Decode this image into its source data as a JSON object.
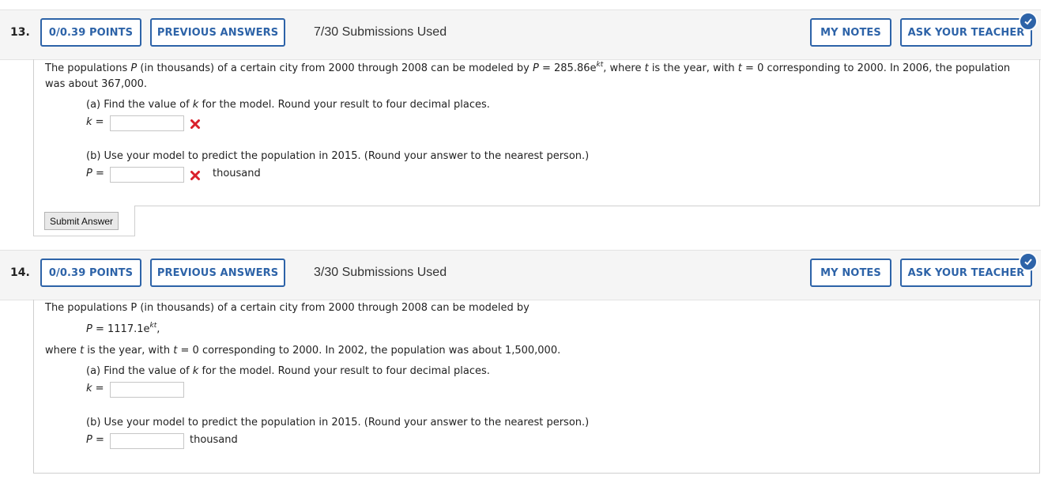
{
  "questions": [
    {
      "number": "13.",
      "points_label": "0/0.39 POINTS",
      "previous_answers_label": "PREVIOUS ANSWERS",
      "submissions": "7/30 Submissions Used",
      "my_notes_label": "MY NOTES",
      "ask_teacher_label": "ASK YOUR TEACHER",
      "intro_pre": "The populations ",
      "var_p": "P",
      "intro_mid": " (in thousands) of a certain city from 2000 through 2008 can be modeled by ",
      "model_eq": " = 285.86e",
      "model_exp": "kt",
      "intro_post": ", where ",
      "var_t": "t",
      "intro_post2": " is the year, with ",
      "intro_post3": " = 0 corresponding to 2000. In 2006, the population was about 367,000.",
      "part_a": "(a) Find the value of ",
      "part_a_var": "k",
      "part_a_post": " for the model. Round your result to four decimal places.",
      "k_label": " =",
      "k_value": "",
      "part_b": "(b) Use your model to predict the population in 2015. (Round your answer to the nearest person.)",
      "p_label": " =",
      "p_value": "",
      "unit": "thousand",
      "submit_label": "Submit Answer",
      "status_color": "#d9202b"
    },
    {
      "number": "14.",
      "points_label": "0/0.39 POINTS",
      "previous_answers_label": "PREVIOUS ANSWERS",
      "submissions": "3/30 Submissions Used",
      "my_notes_label": "MY NOTES",
      "ask_teacher_label": "ASK YOUR TEACHER",
      "intro": "The populations P (in thousands) of a certain city from 2000 through 2008 can be modeled by",
      "model_eq": " = 1117.1e",
      "model_exp": "kt",
      "model_tail": ",",
      "where_text": " is the year, with ",
      "where_text2": " = 0 corresponding to 2000. In 2002, the population was about 1,500,000.",
      "part_a_post": " for the model. Round your result to four decimal places.",
      "part_b": "(b) Use your model to predict the population in 2015. (Round your answer to the nearest person.)",
      "unit": "thousand",
      "k_value": "",
      "p_value": ""
    }
  ],
  "accent_color": "#2d63a8"
}
